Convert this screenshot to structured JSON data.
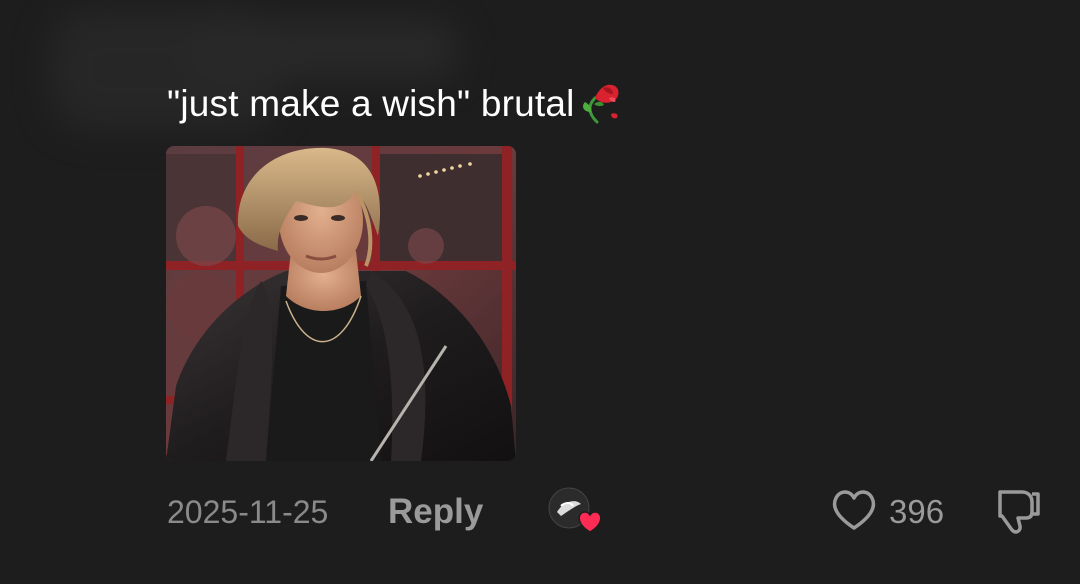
{
  "comment": {
    "text": "\"just make a wish\" brutal",
    "emoji": "wilted-rose-emoji",
    "attachment_icon": "photo-attachment"
  },
  "footer": {
    "timestamp": "2025-11-25",
    "reply_label": "Reply",
    "like_count": "396",
    "icons": {
      "like": "heart-outline-icon",
      "dislike": "thumbs-down-outline-icon",
      "creator_liked": "creator-avatar-heart-icon"
    }
  },
  "colors": {
    "background": "#1d1d1d",
    "text_primary": "#ffffff",
    "text_secondary": "#8a8a8a",
    "heart_badge": "#fe2c55"
  }
}
